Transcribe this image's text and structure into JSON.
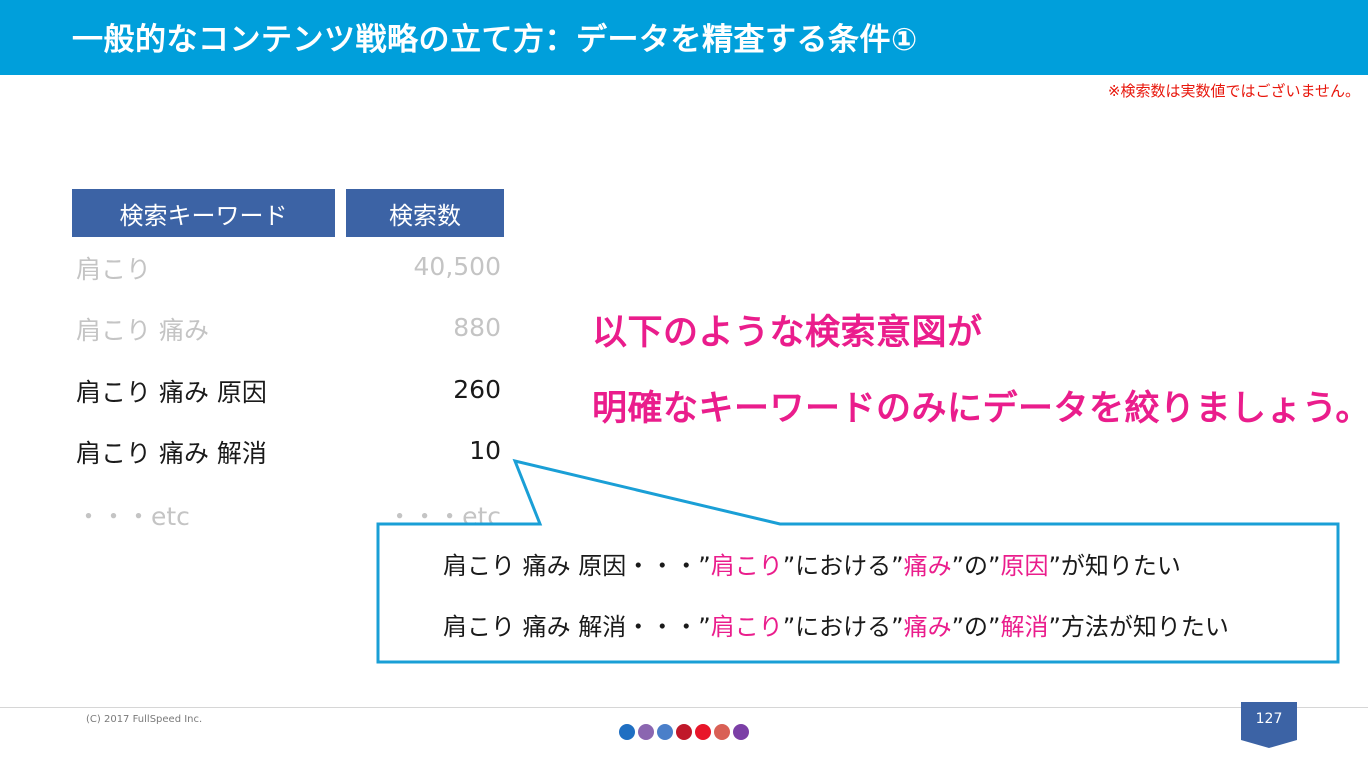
{
  "header": {
    "title": "一般的なコンテンツ戦略の立て方：データを精査する条件①",
    "bg_color": "#009fdb"
  },
  "note": "※検索数は実数値ではございません。",
  "table": {
    "headers": {
      "keyword": "検索キーワード",
      "count": "検索数"
    },
    "header_color": "#3c63a5",
    "rows": [
      {
        "keyword": "肩こり",
        "count": "40,500",
        "state": "dimmed"
      },
      {
        "keyword": "肩こり 痛み",
        "count": "880",
        "state": "dimmed"
      },
      {
        "keyword": "肩こり 痛み 原因",
        "count": "260",
        "state": "highlighted"
      },
      {
        "keyword": "肩こり 痛み 解消",
        "count": "10",
        "state": "highlighted"
      },
      {
        "keyword": "・・・etc",
        "count": "・・・etc",
        "state": "dimmed"
      }
    ]
  },
  "message": {
    "line1": "以下のような検索意図が",
    "line2": "明確なキーワードのみにデータを絞りましょう。",
    "color": "#ea1d8c"
  },
  "callout": {
    "line1": {
      "p1": "肩こり 痛み 原因・・・”",
      "h1": "肩こり",
      "p2": "”における”",
      "h2": "痛み",
      "p3": "”の”",
      "h3": "原因",
      "p4": "”が知りたい"
    },
    "line2": {
      "p1": "肩こり 痛み 解消・・・”",
      "h1": "肩こり",
      "p2": "”における”",
      "h2": "痛み",
      "p3": "”の”",
      "h3": "解消",
      "p4": "”方法が知りたい"
    },
    "border_color": "#1a9fd6"
  },
  "footer": {
    "copyright": "(C) 2017 FullSpeed Inc.",
    "page_number": "127",
    "dot_colors": [
      "#1f6fc2",
      "#8b66b0",
      "#4a7fc9",
      "#c0182a",
      "#e8162a",
      "#d96055",
      "#7b3fa6"
    ],
    "badge_color": "#3c63a5"
  }
}
